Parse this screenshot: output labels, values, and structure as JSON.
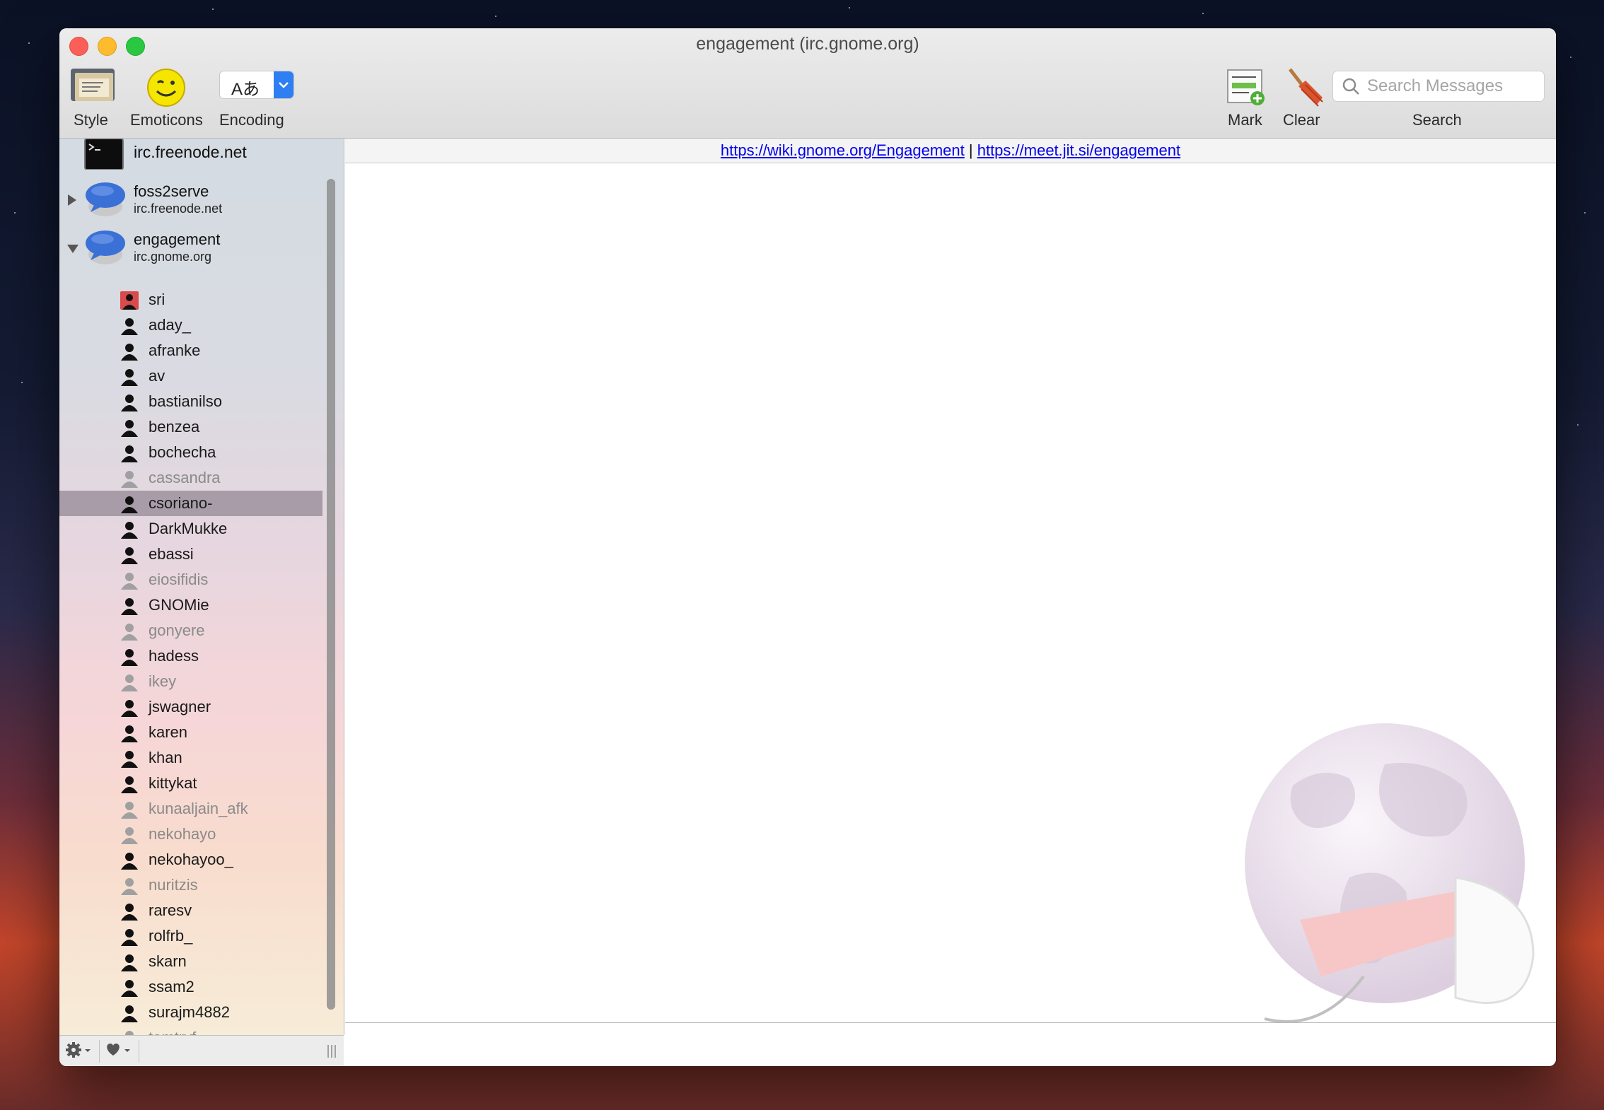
{
  "window": {
    "title": "engagement (irc.gnome.org)"
  },
  "toolbar": {
    "style_label": "Style",
    "emoticons_label": "Emoticons",
    "encoding_label": "Encoding",
    "encoding_glyph": "Aあ",
    "mark_label": "Mark",
    "clear_label": "Clear",
    "search_label": "Search",
    "search_placeholder": "Search Messages"
  },
  "sidebar": {
    "servers": [
      {
        "name": "irc.freenode.net"
      },
      {
        "name": "foss2serve",
        "host": "irc.freenode.net",
        "expanded": false
      },
      {
        "name": "engagement",
        "host": "irc.gnome.org",
        "expanded": true
      }
    ],
    "nicks": [
      {
        "name": "sri",
        "status": "op"
      },
      {
        "name": "aday_",
        "status": "here"
      },
      {
        "name": "afranke",
        "status": "here"
      },
      {
        "name": "av",
        "status": "here"
      },
      {
        "name": "bastianilso",
        "status": "here"
      },
      {
        "name": "benzea",
        "status": "here"
      },
      {
        "name": "bochecha",
        "status": "here"
      },
      {
        "name": "cassandra",
        "status": "away"
      },
      {
        "name": "csoriano-",
        "status": "selected"
      },
      {
        "name": "DarkMukke",
        "status": "here"
      },
      {
        "name": "ebassi",
        "status": "here"
      },
      {
        "name": "eiosifidis",
        "status": "away"
      },
      {
        "name": "GNOMie",
        "status": "here"
      },
      {
        "name": "gonyere",
        "status": "away"
      },
      {
        "name": "hadess",
        "status": "here"
      },
      {
        "name": "ikey",
        "status": "away"
      },
      {
        "name": "jswagner",
        "status": "here"
      },
      {
        "name": "karen",
        "status": "here"
      },
      {
        "name": "khan",
        "status": "here"
      },
      {
        "name": "kittykat",
        "status": "here"
      },
      {
        "name": "kunaaljain_afk",
        "status": "away"
      },
      {
        "name": "nekohayo",
        "status": "away"
      },
      {
        "name": "nekohayoo_",
        "status": "here"
      },
      {
        "name": "nuritzis",
        "status": "away"
      },
      {
        "name": "raresv",
        "status": "here"
      },
      {
        "name": "rolfrb_",
        "status": "here"
      },
      {
        "name": "skarn",
        "status": "here"
      },
      {
        "name": "ssam2",
        "status": "here"
      },
      {
        "name": "surajm4882",
        "status": "here"
      },
      {
        "name": "tomtryf",
        "status": "away"
      }
    ]
  },
  "topic": {
    "link1": "https://wiki.gnome.org/Engagement",
    "separator": "|",
    "link2": "https://meet.jit.si/engagement"
  },
  "colors": {
    "selection": "#a89ca8",
    "link": "#0000ee",
    "close": "#fc5f57",
    "minimize": "#fdbc2e",
    "maximize": "#29c840"
  },
  "icons": {
    "style": "style-icon",
    "emoticons": "smiley-icon",
    "mark": "mark-icon",
    "clear": "broom-icon",
    "gear": "gear-icon",
    "heart": "heart-icon"
  }
}
